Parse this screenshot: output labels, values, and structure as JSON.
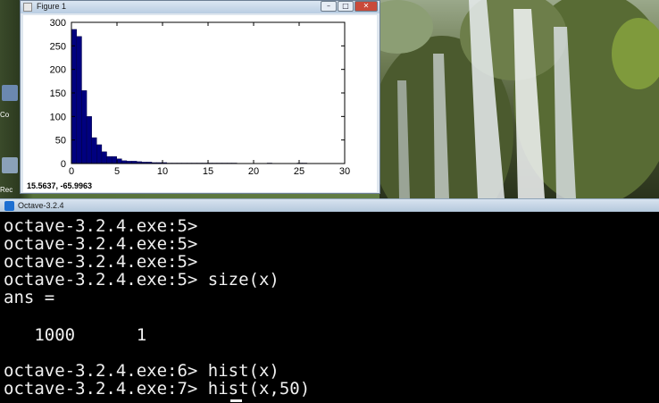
{
  "desktop": {
    "icon_labels": [
      "Co",
      "Rec"
    ]
  },
  "figure": {
    "title": "Figure 1",
    "buttons": {
      "minimize": "–",
      "maximize": "□",
      "close": "✕"
    },
    "coordinate_readout": "15.5637, -65.9963"
  },
  "chart_data": {
    "type": "bar",
    "bins": 50,
    "xlim": [
      0,
      30
    ],
    "ylim": [
      0,
      300
    ],
    "xticks": [
      0,
      5,
      10,
      15,
      20,
      25,
      30
    ],
    "yticks": [
      0,
      50,
      100,
      150,
      200,
      250,
      300
    ],
    "bar_color": "#00007f",
    "bin_width": 0.55,
    "x": [
      0.3,
      0.85,
      1.4,
      1.95,
      2.5,
      3.05,
      3.6,
      4.15,
      4.7,
      5.25,
      5.8,
      6.35,
      6.9,
      7.45,
      8.0,
      8.55,
      9.1,
      9.65,
      10.2,
      10.75,
      11.3,
      11.85,
      12.4,
      12.95,
      13.5,
      14.05,
      14.6,
      15.15,
      15.7,
      16.25,
      16.8,
      17.35,
      17.9,
      18.45,
      19.0,
      19.55,
      20.1,
      20.65,
      21.2,
      21.75,
      22.3,
      22.85,
      23.4,
      23.95,
      24.5,
      25.05,
      25.6,
      26.15,
      26.7,
      27.25
    ],
    "values": [
      285,
      270,
      155,
      100,
      55,
      40,
      25,
      15,
      15,
      10,
      6,
      5,
      5,
      4,
      3,
      3,
      2,
      2,
      2,
      1,
      1,
      1,
      1,
      1,
      1,
      1,
      1,
      1,
      1,
      1,
      1,
      1,
      1,
      0,
      0,
      0,
      0,
      0,
      0,
      1,
      0,
      0,
      0,
      0,
      0,
      1,
      1,
      0,
      0,
      0
    ]
  },
  "terminal": {
    "title": "Octave-3.2.4",
    "lines": [
      "octave-3.2.4.exe:5>",
      "octave-3.2.4.exe:5>",
      "octave-3.2.4.exe:5>",
      "octave-3.2.4.exe:5> size(x)",
      "ans =",
      "",
      "   1000      1",
      "",
      "octave-3.2.4.exe:6> hist(x)",
      "octave-3.2.4.exe:7> hist(x,50)"
    ]
  }
}
